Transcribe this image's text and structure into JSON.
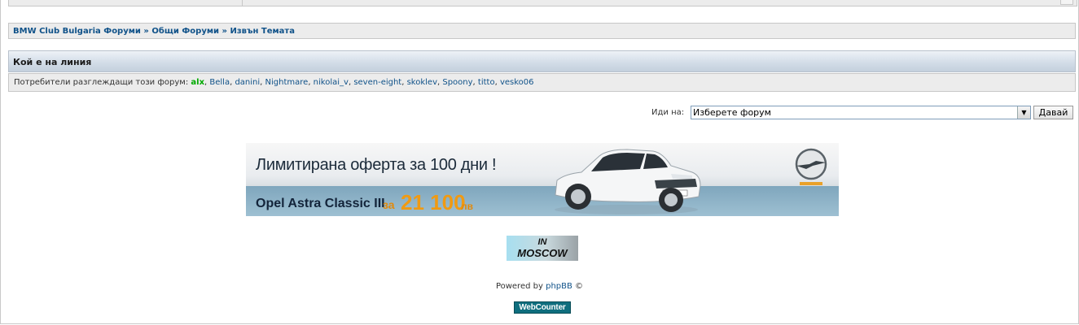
{
  "breadcrumb": {
    "items": [
      "BMW Club Bulgaria Форуми",
      "Общи Форуми",
      "Извън Темата"
    ],
    "separator": "»"
  },
  "online": {
    "heading": "Кой е на линия",
    "label": "Потребители разглеждащи този форум:",
    "moderator": "alx",
    "users": [
      "Bella",
      "danini",
      "Nightmare",
      "nikolai_v",
      "seven-eight",
      "skoklev",
      "Spoony",
      "titto",
      "vesko06"
    ]
  },
  "jump": {
    "label": "Иди на:",
    "selected": "Изберете форум",
    "button": "Давай"
  },
  "banner": {
    "headline": "Лимитирана оферта за 100 дни !",
    "model": "Opel Astra Classic III",
    "price_prefix": "за",
    "price": "21 100",
    "price_suffix": "лв"
  },
  "moscow_badge": {
    "line1": "IN",
    "line2": "MOSCOW"
  },
  "footer": {
    "powered_prefix": "Powered by",
    "powered_link": "phpBB",
    "copyright": "©",
    "counter": "WebCounter"
  },
  "colors": {
    "link": "#105289",
    "moderator": "#00aa00",
    "price": "#f09a12",
    "counter_bg": "#0f6e7e"
  }
}
